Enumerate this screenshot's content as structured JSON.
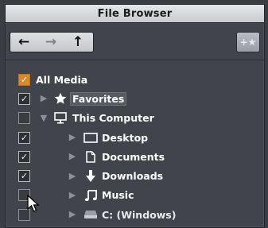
{
  "window": {
    "title": "File Browser"
  },
  "toolbar": {
    "back_label": "←",
    "forward_label": "→",
    "up_label": "↑",
    "add_favorite_label": "+★"
  },
  "tree": {
    "items": [
      {
        "label": "All Media",
        "checked": true,
        "check_style": "orange",
        "icon": "none",
        "expanded": null,
        "level": 0
      },
      {
        "label": "Favorites",
        "checked": true,
        "icon": "star-icon",
        "expanded": false,
        "level": 0,
        "selected": true
      },
      {
        "label": "This Computer",
        "checked": false,
        "icon": "monitor-icon",
        "expanded": true,
        "level": 0
      },
      {
        "label": "Desktop",
        "checked": true,
        "icon": "desktop-icon",
        "expanded": false,
        "level": 1
      },
      {
        "label": "Documents",
        "checked": true,
        "icon": "document-icon",
        "expanded": false,
        "level": 1
      },
      {
        "label": "Downloads",
        "checked": true,
        "icon": "download-icon",
        "expanded": false,
        "level": 1
      },
      {
        "label": "Music",
        "checked": false,
        "icon": "music-icon",
        "expanded": false,
        "level": 1
      },
      {
        "label": "C: (Windows)",
        "checked": false,
        "icon": "drive-icon",
        "expanded": false,
        "level": 1
      }
    ]
  },
  "colors": {
    "background": "#41444a",
    "accent_orange": "#d98a28",
    "text": "#ffffff"
  }
}
